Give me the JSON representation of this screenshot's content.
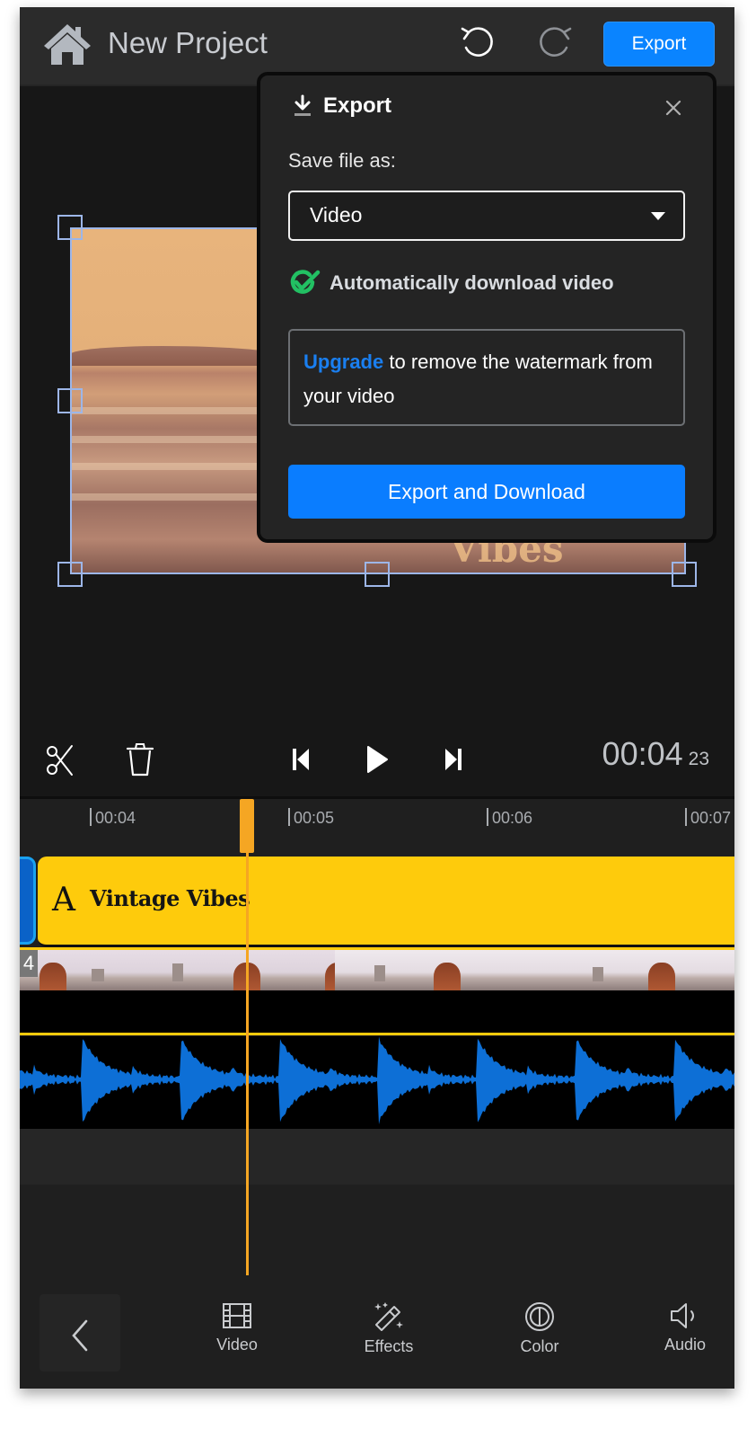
{
  "header": {
    "title": "New Project",
    "export_label": "Export",
    "icons": {
      "home": "home-icon",
      "undo": "undo-icon",
      "redo": "redo-icon"
    }
  },
  "preview": {
    "watermark_text": "Vibes"
  },
  "export_popup": {
    "title": "Export",
    "title_icon": "download-icon",
    "save_as_label": "Save file as:",
    "save_as_value": "Video",
    "auto_download_label": "Automatically download video",
    "auto_download_checked": true,
    "upgrade_link": "Upgrade",
    "upgrade_text": " to remove the watermark from your video",
    "primary_button": "Export and Download",
    "close_icon": "close-icon"
  },
  "controls": {
    "time": "00:04",
    "frames": "23",
    "icons": [
      "scissors-icon",
      "trash-icon",
      "skip-back-icon",
      "play-icon",
      "skip-forward-icon"
    ]
  },
  "timeline": {
    "ticks": [
      "00:04",
      "00:05",
      "00:06",
      "00:07"
    ],
    "text_clip_name": "Vintage Vibes",
    "text_clip_icon": "A",
    "video_clip_number": "4"
  },
  "bottom_bar": {
    "tools": [
      {
        "label": "Video",
        "icon": "film-icon"
      },
      {
        "label": "Effects",
        "icon": "magic-wand-icon"
      },
      {
        "label": "Color",
        "icon": "color-icon"
      },
      {
        "label": "Audio",
        "icon": "speaker-icon"
      }
    ]
  },
  "colors": {
    "accent": "#0a84ff",
    "playhead": "#f5a623",
    "text_clip": "#fecb0c",
    "waveform": "#0d6fd6",
    "checkmark": "#22c063"
  }
}
